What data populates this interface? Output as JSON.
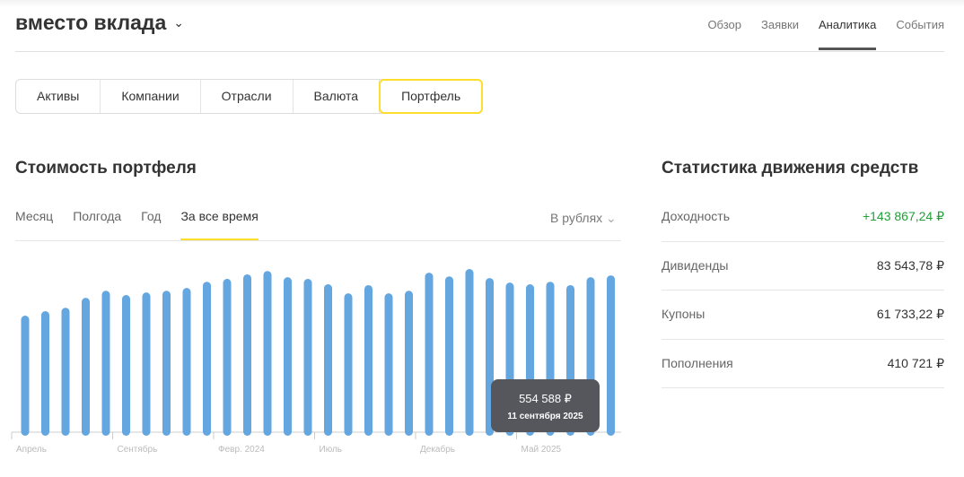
{
  "header": {
    "title": "вместо вклада",
    "nav": [
      "Обзор",
      "Заявки",
      "Аналитика",
      "События"
    ],
    "active_nav": "Аналитика"
  },
  "tabs": [
    "Активы",
    "Компании",
    "Отрасли",
    "Валюта",
    "Портфель"
  ],
  "portfolio": {
    "title": "Стоимость портфеля",
    "periods": [
      "Месяц",
      "Полгода",
      "Год",
      "За все время"
    ],
    "currency_select": "В рублях",
    "tooltip": {
      "value": "554 588 ₽",
      "date": "11 сентября 2025"
    }
  },
  "stats": {
    "title": "Статистика движения средств",
    "rows": [
      {
        "label": "Доходность",
        "value": "+143 867,24 ₽"
      },
      {
        "label": "Дивиденды",
        "value": "83 543,78 ₽"
      },
      {
        "label": "Купоны",
        "value": "61 733,22 ₽"
      },
      {
        "label": "Пополнения",
        "value": "410 721 ₽"
      }
    ]
  },
  "colors": {
    "bar": "#64a6e0",
    "accent": "#ffdd2d",
    "positive": "#21a038"
  },
  "chart_data": {
    "type": "bar",
    "title": "Стоимость портфеля",
    "ylim": [
      0,
      610000
    ],
    "x_tick_labels": [
      {
        "label": "Апрель",
        "index": 0
      },
      {
        "label": "Сентябрь",
        "index": 5
      },
      {
        "label": "Февр. 2024",
        "index": 10
      },
      {
        "label": "Июль",
        "index": 15
      },
      {
        "label": "Декабрь",
        "index": 20
      },
      {
        "label": "Май 2025",
        "index": 25
      }
    ],
    "values": [
      412000,
      428000,
      440000,
      475000,
      500000,
      485000,
      494000,
      500000,
      510000,
      532000,
      542000,
      558000,
      570000,
      548000,
      542000,
      523000,
      491000,
      520000,
      491000,
      500000,
      564000,
      551000,
      577000,
      545000,
      529000,
      523000,
      532000,
      520000,
      548000,
      554588
    ]
  }
}
